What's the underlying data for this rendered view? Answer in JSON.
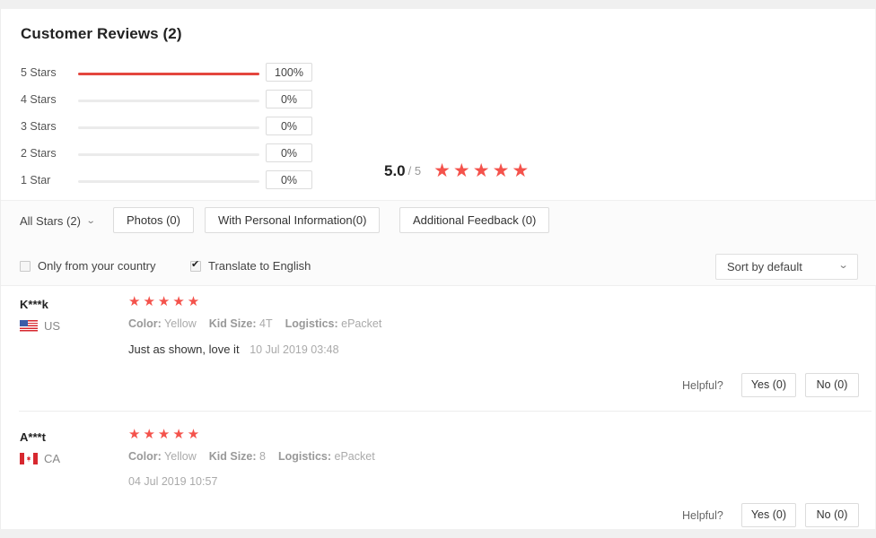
{
  "header": {
    "title": "Customer Reviews (2)"
  },
  "rating_summary": {
    "score": "5.0",
    "out_of": "/ 5",
    "stars": "★★★★★",
    "breakdown": [
      {
        "label": "5 Stars",
        "percent_label": "100%",
        "percent": 100
      },
      {
        "label": "4 Stars",
        "percent_label": "0%",
        "percent": 0
      },
      {
        "label": "3 Stars",
        "percent_label": "0%",
        "percent": 0
      },
      {
        "label": "2 Stars",
        "percent_label": "0%",
        "percent": 0
      },
      {
        "label": "1 Star",
        "percent_label": "0%",
        "percent": 0
      }
    ]
  },
  "filters": {
    "all_stars_label": "All Stars (2)",
    "chevron": "⌄",
    "buttons": [
      {
        "label": "Photos (0)"
      },
      {
        "label": "With Personal Information(0)"
      },
      {
        "label": "Additional Feedback (0)"
      }
    ]
  },
  "options": {
    "only_country": {
      "label": "Only from your country",
      "checked": false
    },
    "translate": {
      "label": "Translate to English",
      "checked": true
    },
    "sort": {
      "value": "Sort by default",
      "chevron": "⌄"
    }
  },
  "reviews": [
    {
      "user": "K***k",
      "country": "US",
      "flag": "us-flag-icon",
      "stars": "★★★★★",
      "attributes": [
        {
          "key": "Color:",
          "value": "Yellow"
        },
        {
          "key": "Kid Size:",
          "value": "4T"
        },
        {
          "key": "Logistics:",
          "value": "ePacket"
        }
      ],
      "text": "Just as shown, love it",
      "date": "10 Jul 2019 03:48",
      "helpful_label": "Helpful?",
      "yes_label": "Yes (0)",
      "no_label": "No (0)"
    },
    {
      "user": "A***t",
      "country": "CA",
      "flag": "ca-flag-icon",
      "stars": "★★★★★",
      "attributes": [
        {
          "key": "Color:",
          "value": "Yellow"
        },
        {
          "key": "Kid Size:",
          "value": "8"
        },
        {
          "key": "Logistics:",
          "value": "ePacket"
        }
      ],
      "text": "",
      "date": "04 Jul 2019 10:57",
      "helpful_label": "Helpful?",
      "yes_label": "Yes (0)",
      "no_label": "No (0)"
    }
  ],
  "colors": {
    "accent_red": "#e4463e",
    "star_red": "#f4524b",
    "page_bg": "#f0f0f0",
    "card_bg": "#ffffff",
    "filter_bg": "#fbfbfb"
  }
}
